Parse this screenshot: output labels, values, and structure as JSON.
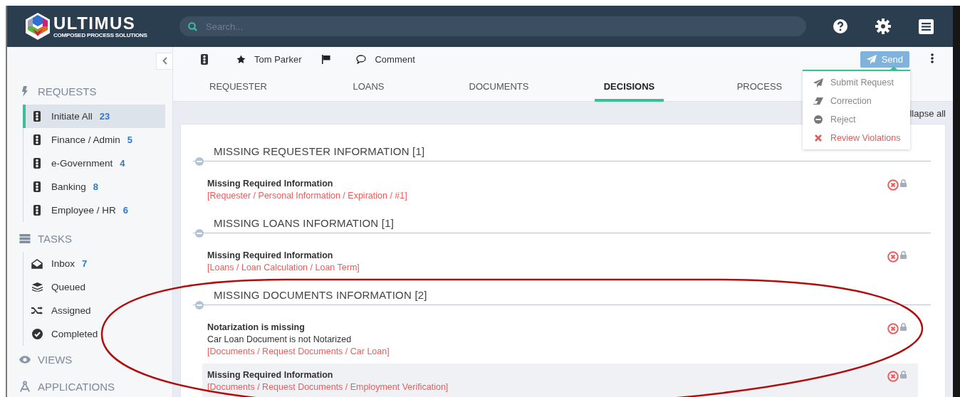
{
  "header": {
    "logo": {
      "name": "ULTIMUS",
      "tagline": "COMPOSED PROCESS SOLUTIONS"
    },
    "search": {
      "placeholder": "Search..."
    }
  },
  "sidebar": {
    "sections": [
      {
        "title": "REQUESTS",
        "items": [
          {
            "label": "Initiate All",
            "count": "23",
            "selected": true
          },
          {
            "label": "Finance / Admin",
            "count": "5",
            "selected": false
          },
          {
            "label": "e-Government",
            "count": "4",
            "selected": false
          },
          {
            "label": "Banking",
            "count": "8",
            "selected": false
          },
          {
            "label": "Employee / HR",
            "count": "6",
            "selected": false
          }
        ]
      },
      {
        "title": "TASKS",
        "items": [
          {
            "label": "Inbox",
            "count": "7",
            "selected": false
          },
          {
            "label": "Queued",
            "selected": false
          },
          {
            "label": "Assigned",
            "selected": false
          },
          {
            "label": "Completed",
            "selected": false
          }
        ]
      },
      {
        "title": "VIEWS"
      },
      {
        "title": "APPLICATIONS"
      }
    ]
  },
  "toolbar": {
    "assignee": "Tom Parker",
    "comment": "Comment",
    "send": "Send"
  },
  "tabs": [
    {
      "label": "REQUESTER",
      "selected": false
    },
    {
      "label": "LOANS",
      "selected": false
    },
    {
      "label": "DOCUMENTS",
      "selected": false
    },
    {
      "label": "DECISIONS",
      "selected": true
    },
    {
      "label": "PROCESS",
      "selected": false
    }
  ],
  "send_menu": {
    "items": [
      {
        "label": "Submit Request",
        "kind": "submit"
      },
      {
        "label": "Correction",
        "kind": "correction"
      },
      {
        "label": "Reject",
        "kind": "reject"
      },
      {
        "label": "Review Violations",
        "kind": "violations"
      }
    ]
  },
  "collapse_all": "llapse all",
  "sections": [
    {
      "title": "MISSING REQUESTER INFORMATION [1]",
      "items": [
        {
          "title": "Missing Required Information",
          "path": "[Requester / Personal Information / Expiration / #1]",
          "highlighted": false
        }
      ]
    },
    {
      "title": "MISSING LOANS INFORMATION [1]",
      "items": [
        {
          "title": "Missing Required Information",
          "path": "[Loans / Loan Calculation / Loan Term]",
          "highlighted": false
        }
      ]
    },
    {
      "title": "MISSING DOCUMENTS INFORMATION [2]",
      "items": [
        {
          "title": "Notarization is missing",
          "detail": "Car Loan Document is not Notarized",
          "path": "[Documents / Request Documents / Car Loan]",
          "highlighted": false
        },
        {
          "title": "Missing Required Information",
          "path": "[Documents / Request Documents / Employment Verification]",
          "highlighted": true
        }
      ]
    }
  ]
}
